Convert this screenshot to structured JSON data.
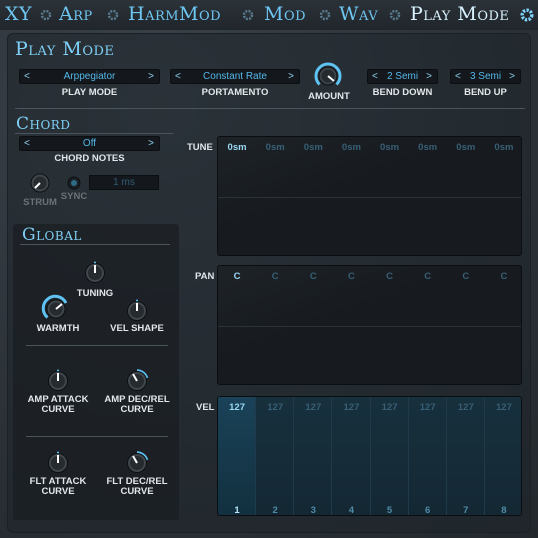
{
  "nav": {
    "tabs": [
      {
        "label": "XY"
      },
      {
        "label": "Arp"
      },
      {
        "label": "HarmMod"
      },
      {
        "label": "Mod"
      },
      {
        "label": "Wav"
      },
      {
        "label": "Play Mode"
      }
    ],
    "active_tab": "Play Mode",
    "icon": "gear-icon"
  },
  "play_mode": {
    "title": "Play Mode",
    "mode": {
      "value": "Arppegiator",
      "label": "PLAY MODE"
    },
    "portamento": {
      "value": "Constant Rate",
      "label": "PORTAMENTO"
    },
    "amount": {
      "label": "AMOUNT"
    },
    "bend_down": {
      "value": "2 Semi",
      "label": "BEND DOWN"
    },
    "bend_up": {
      "value": "3 Semi",
      "label": "BEND UP"
    }
  },
  "chord": {
    "title": "Chord",
    "notes": {
      "value": "Off",
      "label": "CHORD NOTES"
    },
    "strum": {
      "label": "STRUM"
    },
    "sync": {
      "label": "SYNC"
    },
    "time": {
      "value": "1 ms"
    }
  },
  "global": {
    "title": "Global",
    "tuning": {
      "label": "TUNING"
    },
    "warmth": {
      "label": "WARMTH"
    },
    "vel_shape": {
      "label": "VEL SHAPE"
    },
    "amp_attack": {
      "line1": "AMP ATTACK",
      "line2": "CURVE"
    },
    "amp_decrel": {
      "line1": "AMP DEC/REL",
      "line2": "CURVE"
    },
    "flt_attack": {
      "line1": "FLT ATTACK",
      "line2": "CURVE"
    },
    "flt_decrel": {
      "line1": "FLT DEC/REL",
      "line2": "CURVE"
    }
  },
  "steps": {
    "tune": {
      "label": "TUNE",
      "values": [
        "0sm",
        "0sm",
        "0sm",
        "0sm",
        "0sm",
        "0sm",
        "0sm",
        "0sm"
      ]
    },
    "pan": {
      "label": "PAN",
      "values": [
        "C",
        "C",
        "C",
        "C",
        "C",
        "C",
        "C",
        "C"
      ]
    },
    "vel": {
      "label": "VEL",
      "values": [
        "127",
        "127",
        "127",
        "127",
        "127",
        "127",
        "127",
        "127"
      ],
      "numbers": [
        "1",
        "2",
        "3",
        "4",
        "5",
        "6",
        "7",
        "8"
      ]
    },
    "active_step": 1
  },
  "colors": {
    "accent": "#6fc6f2",
    "active_text": "#d8f3ff",
    "value_text": "#53b7e8"
  }
}
